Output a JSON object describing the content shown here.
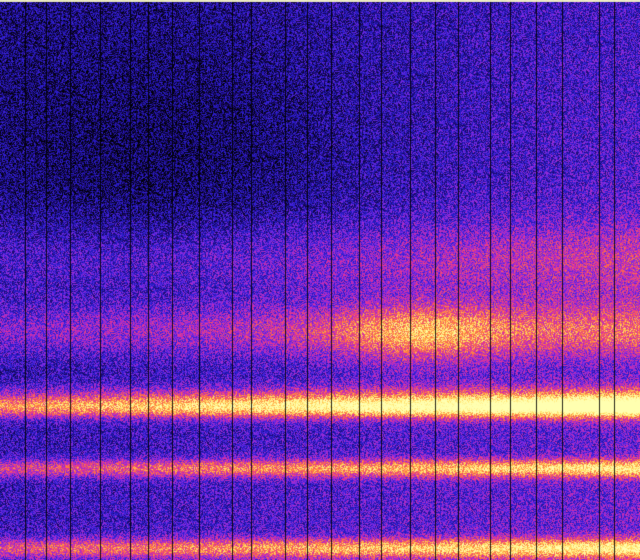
{
  "spectrogram": {
    "colormap": [
      "#000000",
      "#1a0a6e",
      "#2b1fd4",
      "#8a2be2",
      "#e0309a",
      "#ff7a3c",
      "#ffe066",
      "#ffffb0"
    ],
    "background_color": "#05031a",
    "bands": [
      {
        "name": "upper-faint-band",
        "intensity": 0.35
      },
      {
        "name": "mid-band-1",
        "intensity": 0.55
      },
      {
        "name": "mid-band-2",
        "intensity": 0.75
      },
      {
        "name": "bright-band",
        "intensity": 0.9
      },
      {
        "name": "brightest-band",
        "intensity": 0.95
      },
      {
        "name": "bottom-band",
        "intensity": 1.0
      }
    ],
    "vertical_line_count": 24
  }
}
